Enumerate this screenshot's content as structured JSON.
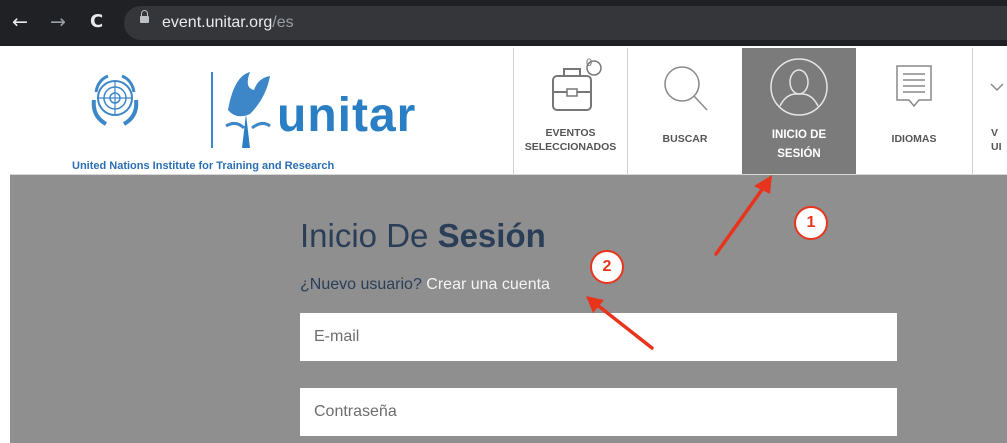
{
  "browser": {
    "back_glyph": "←",
    "forward_glyph": "→",
    "reload_glyph": "C",
    "url_host": "event.unitar.org",
    "url_path": "/es"
  },
  "brand": {
    "name": "unitar",
    "tagline": "United Nations Institute for Training and Research",
    "color": "#2a7ec4"
  },
  "nav": {
    "badge_count": "0",
    "items": [
      {
        "id": "eventos",
        "line1": "EVENTOS",
        "line2": "SELECCIONADOS",
        "icon": "briefcase-icon"
      },
      {
        "id": "buscar",
        "line1": "BUSCAR",
        "line2": "",
        "icon": "search-icon"
      },
      {
        "id": "login",
        "line1": "INICIO DE",
        "line2": "SESIÓN",
        "icon": "user-icon",
        "active": true
      },
      {
        "id": "idiomas",
        "line1": "IDIOMAS",
        "line2": "",
        "icon": "document-icon"
      },
      {
        "id": "partial",
        "line1": "V",
        "line2": "UI",
        "icon": "chevron-icon"
      }
    ]
  },
  "login": {
    "title_regular": "Inicio De ",
    "title_bold": "Sesión",
    "new_user_text": "¿Nuevo usuario? ",
    "create_account_link": "Crear una cuenta",
    "email_placeholder": "E-mail",
    "password_placeholder": "Contraseña"
  },
  "annotations": {
    "badge_1": "1",
    "badge_2": "2",
    "color": "#e8341c"
  },
  "colors": {
    "main_bg": "#8f8f8f",
    "active_tile_bg": "#7b7b7b",
    "title_text": "#2b3e58"
  }
}
